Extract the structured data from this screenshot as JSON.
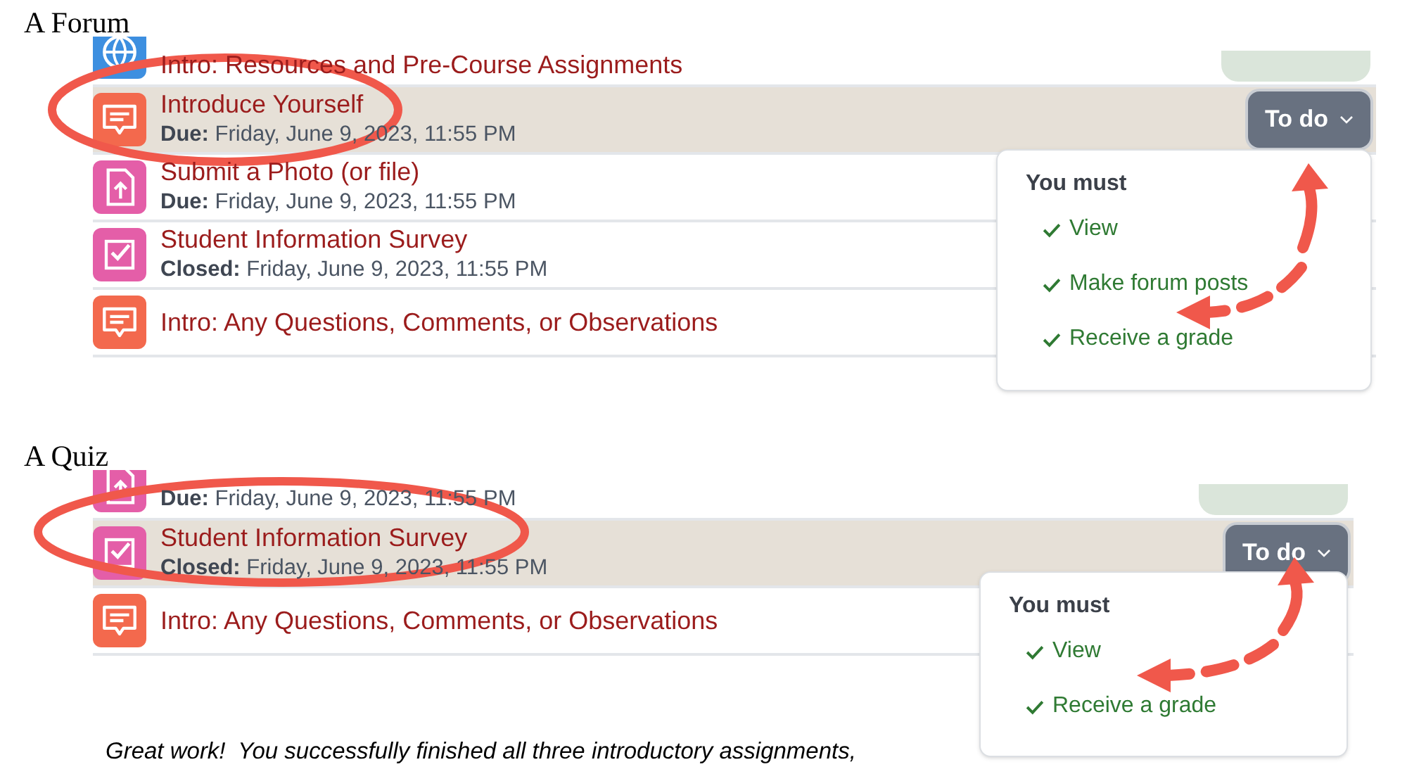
{
  "sections": [
    {
      "heading": "A Forum",
      "activities": [
        {
          "kind": "url",
          "title": "Intro: Resources and Pre-Course Assignments",
          "completion_badge": true,
          "selected": false
        },
        {
          "kind": "forum",
          "title": "Introduce Yourself",
          "date_label": "Due:",
          "date": "Friday, June 9, 2023, 11:55 PM",
          "selected": true,
          "todo": "To do"
        },
        {
          "kind": "assign",
          "title": "Submit a Photo (or file)",
          "date_label": "Due:",
          "date": "Friday, June 9, 2023, 11:55 PM",
          "selected": false
        },
        {
          "kind": "quiz",
          "title": "Student Information Survey",
          "date_label": "Closed:",
          "date": "Friday, June 9, 2023, 11:55 PM",
          "selected": false
        },
        {
          "kind": "forum",
          "title": "Intro: Any Questions, Comments, or Observations",
          "selected": false
        }
      ],
      "dropdown": {
        "heading": "You must",
        "items": [
          "View",
          "Make forum posts",
          "Receive a grade"
        ]
      }
    },
    {
      "heading": "A Quiz",
      "activities": [
        {
          "kind": "assign",
          "date_label": "Due:",
          "date": "Friday, June 9, 2023, 11:55 PM",
          "completion_badge": true,
          "selected": false
        },
        {
          "kind": "quiz",
          "title": "Student Information Survey",
          "date_label": "Closed:",
          "date": "Friday, June 9, 2023, 11:55 PM",
          "selected": true,
          "todo": "To do"
        },
        {
          "kind": "forum",
          "title": "Intro: Any Questions, Comments, or Observations",
          "selected": false
        }
      ],
      "dropdown": {
        "heading": "You must",
        "items": [
          "View",
          "Receive a grade"
        ]
      }
    }
  ],
  "footer": "Great work!  You successfully finished all three introductory assignments,"
}
